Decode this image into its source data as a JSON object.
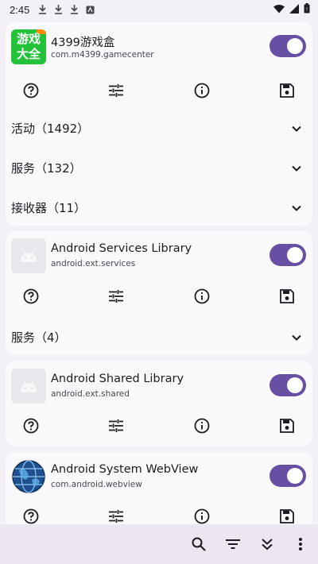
{
  "status_bar": {
    "time": "2:45",
    "icons": [
      "download-icon",
      "download-icon",
      "download-icon",
      "app-notification-icon"
    ],
    "right_icons": [
      "wifi-icon",
      "signal-icon",
      "battery-icon"
    ]
  },
  "apps": [
    {
      "name": "4399游戏盒",
      "package": "com.m4399.gamecenter",
      "icon_text_top": "游戏",
      "icon_text_bottom": "大全",
      "enabled": true,
      "sections": [
        {
          "label": "活动（1492）"
        },
        {
          "label": "服务（132）"
        },
        {
          "label": "接收器（11）"
        }
      ]
    },
    {
      "name": "Android Services Library",
      "package": "android.ext.services",
      "enabled": true,
      "sections": [
        {
          "label": "服务（4）"
        }
      ]
    },
    {
      "name": "Android Shared Library",
      "package": "android.ext.shared",
      "enabled": true,
      "sections": []
    },
    {
      "name": "Android System WebView",
      "package": "com.android.webview",
      "enabled": true,
      "sections": []
    }
  ],
  "actions": [
    "help-icon",
    "tune-icon",
    "info-icon",
    "save-icon"
  ],
  "bottom_bar": {
    "icons": [
      "search-icon",
      "filter-icon",
      "expand-all-icon",
      "more-vert-icon"
    ]
  },
  "colors": {
    "accent": "#6750a4",
    "background": "#f4f0f7",
    "card": "#fcf9fd",
    "bottom_bar": "#ece6f0",
    "icon_green": "#22c33a"
  }
}
